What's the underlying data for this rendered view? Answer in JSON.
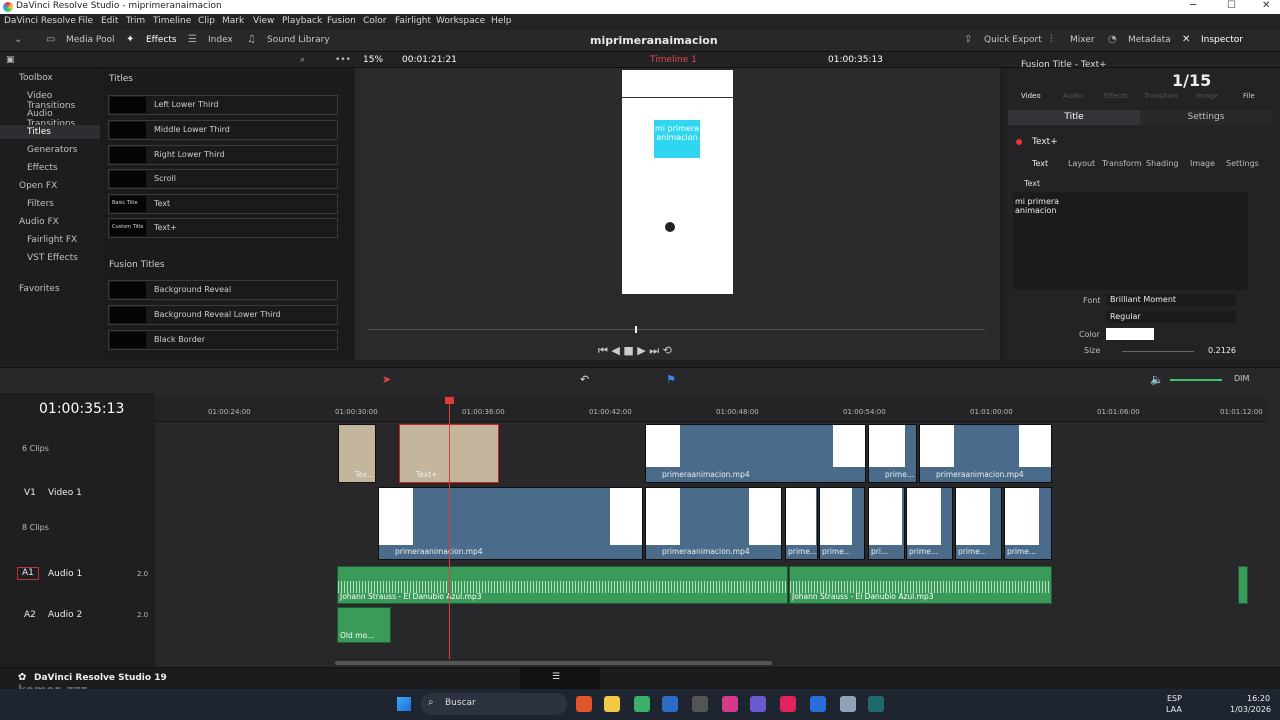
{
  "app": {
    "title": "DaVinci Resolve Studio - miprimeranaimacion",
    "window_controls": [
      "─",
      "☐",
      "✕"
    ]
  },
  "menu": [
    "DaVinci Resolve",
    "File",
    "Edit",
    "Trim",
    "Timeline",
    "Clip",
    "Mark",
    "View",
    "Playback",
    "Fusion",
    "Color",
    "Fairlight",
    "Workspace",
    "Help"
  ],
  "toolbar": {
    "media_pool": "Media Pool",
    "effects": "Effects",
    "index": "Index",
    "sound_library": "Sound Library",
    "project_name": "miprimeranaimacion",
    "quick_export": "Quick Export",
    "mixer": "Mixer",
    "metadata": "Metadata",
    "inspector": "Inspector"
  },
  "viewer_bar": {
    "zoom": "15%",
    "source_tc": "00:01:21:21",
    "timeline_name": "Timeline 1",
    "timecode": "01:00:35:13"
  },
  "toolbox": {
    "items": [
      "Toolbox",
      "Video Transitions",
      "Audio Transitions",
      "Titles",
      "Generators",
      "Effects",
      "Open FX",
      "Filters",
      "Audio FX",
      "Fairlight FX",
      "VST Effects",
      "Favorites"
    ]
  },
  "titles_panel": {
    "header": "Titles",
    "items": [
      {
        "label": "Left Lower Third",
        "thumb": ""
      },
      {
        "label": "Middle Lower Third",
        "thumb": ""
      },
      {
        "label": "Right Lower Third",
        "thumb": ""
      },
      {
        "label": "Scroll",
        "thumb": ""
      },
      {
        "label": "Text",
        "thumb": "Basic Title"
      },
      {
        "label": "Text+",
        "thumb": "Custom Title"
      }
    ],
    "fusion_header": "Fusion Titles",
    "fusion_items": [
      {
        "label": "Background Reveal"
      },
      {
        "label": "Background Reveal Lower Third"
      },
      {
        "label": "Black Border"
      }
    ]
  },
  "viewer": {
    "overlay_text": "mi primera animacion"
  },
  "inspector": {
    "title": "Fusion Title - Text+",
    "page_count": "1/15",
    "tabs": [
      "Video",
      "Audio",
      "Effects",
      "Transition",
      "Image",
      "File"
    ],
    "subtabs": [
      "Title",
      "Settings"
    ],
    "node": "Text+",
    "node_tabs": [
      "Text",
      "Layout",
      "Transform",
      "Shading",
      "Image",
      "Settings"
    ],
    "section": "Text",
    "text_value": "mi primera\nanimacion",
    "font_label": "Font",
    "font": "Brilliant Moment",
    "style": "Regular",
    "color_label": "Color",
    "size_label": "Size",
    "size": "0.2126"
  },
  "timeline": {
    "timecode": "01:00:35:13",
    "dim": "DIM",
    "ruler": [
      "01:00:24:00",
      "01:00:30:00",
      "01:00:36:00",
      "01:00:42:00",
      "01:00:48:00",
      "01:00:54:00",
      "01:01:00:00",
      "01:01:06:00",
      "01:01:12:00"
    ],
    "tracks": [
      {
        "id": "",
        "name": "",
        "clips": "6 Clips"
      },
      {
        "id": "V1",
        "name": "Video 1",
        "clips": "8 Clips"
      },
      {
        "id": "A1",
        "name": "Audio 1",
        "level": "2.0"
      },
      {
        "id": "A2",
        "name": "Audio 2",
        "level": "2.0"
      }
    ],
    "v2_clips": [
      "Tex...",
      "Text+",
      "primeraanimacion.mp4",
      "prime...",
      "primeraanimacion.mp4"
    ],
    "v1_clips": [
      "primeraanimacion.mp4",
      "primeraanimacion.mp4",
      "prime...",
      "prime...",
      "pri...",
      "prime...",
      "prime...",
      "prime..."
    ],
    "a1_clips": [
      "Johann Strauss - El Danubio Azul.mp3",
      "Johann Strauss - El Danubio Azul.mp3"
    ],
    "a2_clips": [
      "Old mo..."
    ]
  },
  "pagebar": {
    "app_name": "DaVinci Resolve Studio 19"
  },
  "watermark": "komer_zzz",
  "taskbar": {
    "search": "Buscar",
    "lang": "ESP",
    "lang2": "LAA",
    "time": "16:20",
    "date": "1/03/2026"
  }
}
